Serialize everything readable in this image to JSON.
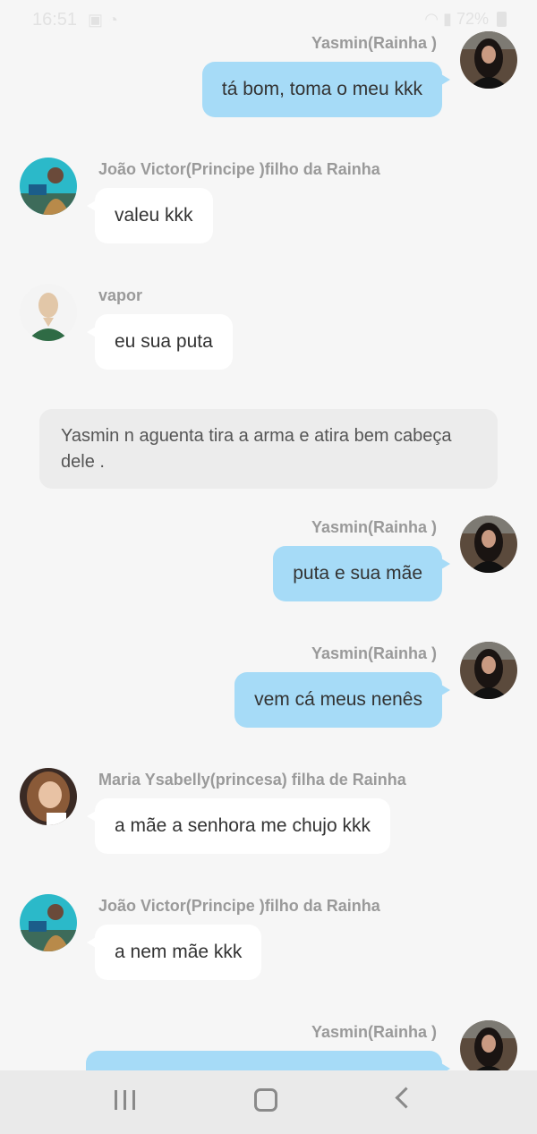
{
  "status_bar": {
    "time": "16:51",
    "battery": "72%"
  },
  "messages": [
    {
      "sender": "Yasmin(Rainha )",
      "text": "tá bom, toma o meu kkk",
      "side": "right",
      "avatar": "yasmin-avatar"
    },
    {
      "sender": "João Victor(Principe )filho da Rainha",
      "text": "valeu kkk",
      "side": "left",
      "avatar": "joao-avatar"
    },
    {
      "sender": "vapor",
      "text": "eu sua puta",
      "side": "left",
      "avatar": "vapor-avatar"
    },
    {
      "type": "system",
      "text": "Yasmin n aguenta tira a arma e atira bem cabeça dele ."
    },
    {
      "sender": "Yasmin(Rainha )",
      "text": "puta e sua mãe",
      "side": "right",
      "avatar": "yasmin-avatar"
    },
    {
      "sender": "Yasmin(Rainha )",
      "text": "vem cá meus nenês",
      "side": "right",
      "avatar": "yasmin-avatar"
    },
    {
      "sender": "Maria Ysabelly(princesa) filha de Rainha",
      "text": "a mãe a senhora me chujo kkk",
      "side": "left",
      "avatar": "maria-avatar"
    },
    {
      "sender": "João Victor(Principe )filho da Rainha",
      "text": "a nem mãe kkk",
      "side": "left",
      "avatar": "joao-avatar"
    },
    {
      "sender": "Yasmin(Rainha )",
      "text": "",
      "side": "right",
      "avatar": "yasmin-avatar"
    }
  ],
  "nav_bar": {
    "icons": [
      "recent-apps-icon",
      "home-icon",
      "back-icon"
    ]
  },
  "colors": {
    "background": "#f6f6f6",
    "my_bubble": "#a6dbf7",
    "their_bubble": "#ffffff",
    "system_bubble": "#ececec",
    "sender_name": "#9a9a9a"
  }
}
